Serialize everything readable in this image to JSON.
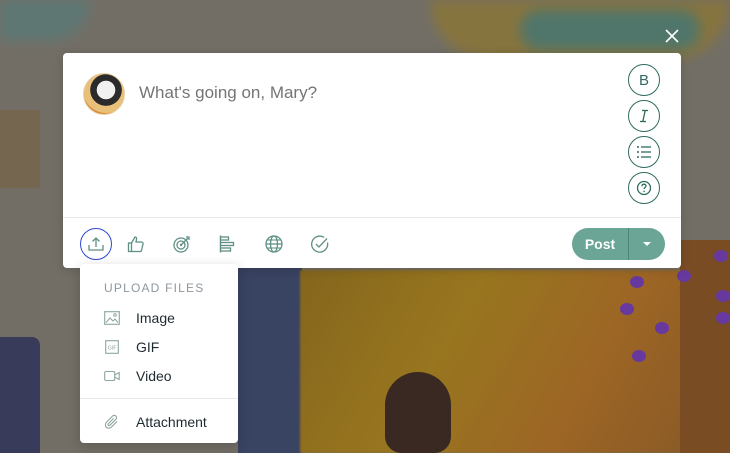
{
  "composer": {
    "placeholder": "What's going on, Mary?",
    "format_buttons": {
      "bold": "B"
    },
    "post_label": "Post"
  },
  "upload_menu": {
    "header": "UPLOAD FILES",
    "items": [
      {
        "label": "Image",
        "icon": "image-icon"
      },
      {
        "label": "GIF",
        "icon": "gif-icon"
      },
      {
        "label": "Video",
        "icon": "video-icon"
      },
      {
        "label": "Attachment",
        "icon": "paperclip-icon"
      }
    ]
  },
  "colors": {
    "accent": "#2f6b5f",
    "post_button": "#6aa595",
    "focus_ring": "#2f48d3"
  }
}
